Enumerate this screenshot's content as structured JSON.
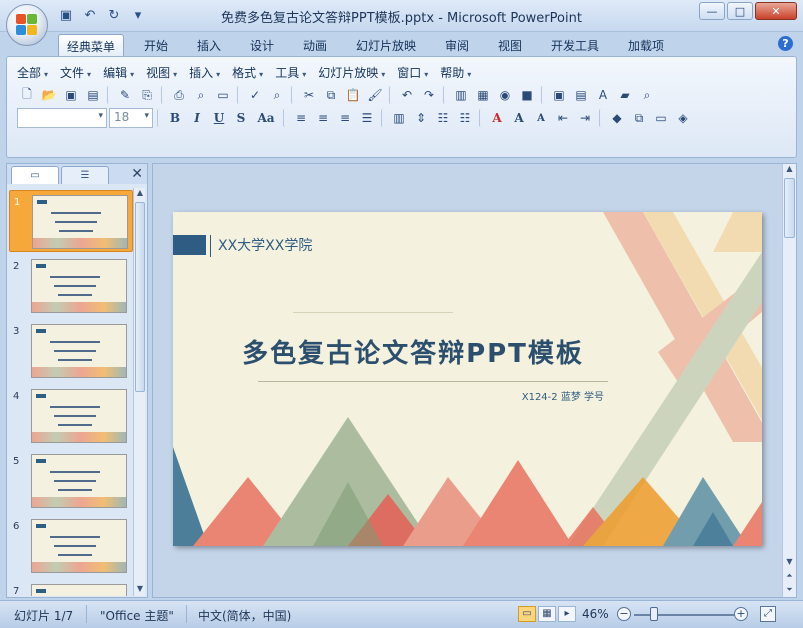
{
  "window": {
    "title": "免费多色复古论文答辩PPT模板.pptx - Microsoft PowerPoint",
    "controls": [
      "—",
      "□",
      "✕"
    ]
  },
  "qat": [
    {
      "name": "save-icon",
      "glyph": "💾"
    },
    {
      "name": "undo-icon",
      "glyph": "↶"
    },
    {
      "name": "redo-icon",
      "glyph": "↻"
    },
    {
      "name": "customize-qat-icon",
      "glyph": "▾"
    }
  ],
  "ribbon": {
    "tabs": [
      "经典菜单",
      "开始",
      "插入",
      "设计",
      "动画",
      "幻灯片放映",
      "审阅",
      "视图",
      "开发工具",
      "加载项"
    ],
    "active_tab": "经典菜单",
    "menus": [
      "全部",
      "文件",
      "编辑",
      "视图",
      "插入",
      "格式",
      "工具",
      "幻灯片放映",
      "窗口",
      "帮助"
    ],
    "font_name": "",
    "font_size": "18",
    "format_buttons": [
      "B",
      "I",
      "U",
      "S",
      "Aa"
    ]
  },
  "pane": {
    "tabs": [
      "slides-tab",
      "outline-tab"
    ],
    "close": "✕",
    "slides": [
      {
        "num": "1",
        "selected": true
      },
      {
        "num": "2",
        "selected": false
      },
      {
        "num": "3",
        "selected": false
      },
      {
        "num": "4",
        "selected": false
      },
      {
        "num": "5",
        "selected": false
      },
      {
        "num": "6",
        "selected": false
      },
      {
        "num": "7",
        "selected": false
      }
    ]
  },
  "slide": {
    "school": "XX大学XX学院",
    "title": "多色复古论文答辩PPT模板",
    "subtitle": "X124-2 蓝梦 学号"
  },
  "status": {
    "slide_counter": "幻灯片 1/7",
    "theme": "\"Office 主题\"",
    "language": "中文(简体，中国)",
    "zoom": "46%",
    "zoom_out": "−",
    "zoom_in": "+"
  },
  "colors": {
    "accent_blue": "#2f5c82",
    "selected_thumb": "#f7a83a",
    "slide_bg": "#f4f1df"
  }
}
